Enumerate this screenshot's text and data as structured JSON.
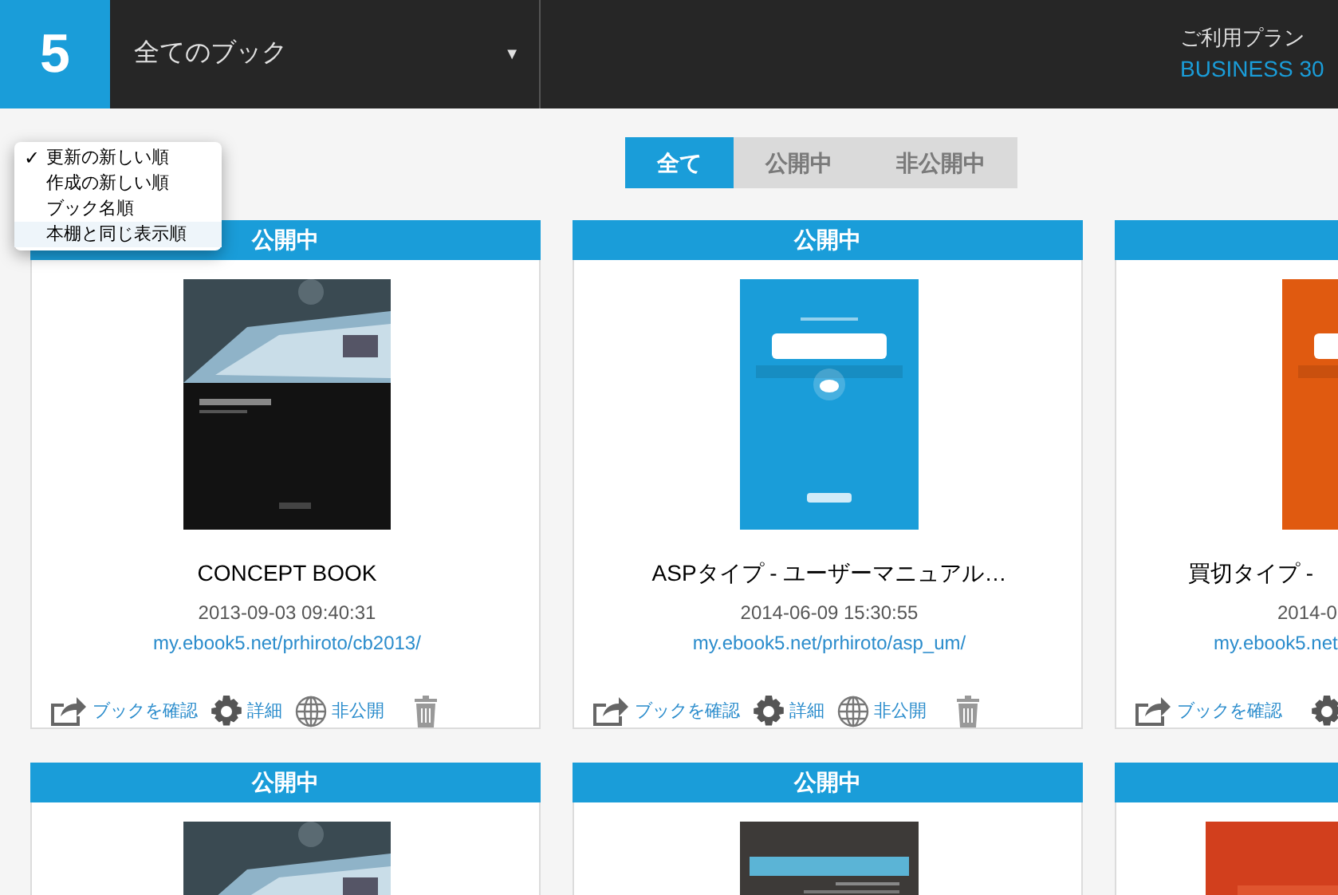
{
  "header": {
    "logo": "5",
    "book_selector": {
      "label": "全てのブック",
      "caret": "▼"
    },
    "plan_label": "ご利用プラン",
    "plan_name": "BUSINESS 30"
  },
  "sort_menu": {
    "check_mark": "✓",
    "items": [
      {
        "label": "更新の新しい順",
        "selected": true,
        "highlighted": false
      },
      {
        "label": "作成の新しい順",
        "selected": false,
        "highlighted": false
      },
      {
        "label": "ブック名順",
        "selected": false,
        "highlighted": false
      },
      {
        "label": "本棚と同じ表示順",
        "selected": false,
        "highlighted": true
      }
    ]
  },
  "filter_tabs": [
    {
      "label": "全て",
      "selected": true
    },
    {
      "label": "公開中",
      "selected": false
    },
    {
      "label": "非公開中",
      "selected": false
    }
  ],
  "book_rows": [
    {
      "cards": [
        {
          "kind": "full",
          "status": "公開中",
          "title": "CONCEPT BOOK",
          "date": "2013-09-03 09:40:31",
          "url": "my.ebook5.net/prhiroto/cb2013/",
          "actions": [
            {
              "kind": "share",
              "label": "ブックを確認"
            },
            {
              "kind": "gear",
              "label": "詳細"
            },
            {
              "kind": "globe",
              "label": "非公開"
            },
            {
              "kind": "trash"
            }
          ]
        },
        {
          "kind": "full",
          "status": "公開中",
          "title": "ASPタイプ - ユーザーマニュアル…",
          "date": "2014-06-09 15:30:55",
          "url": "my.ebook5.net/prhiroto/asp_um/",
          "actions": [
            {
              "kind": "share",
              "label": "ブックを確認"
            },
            {
              "kind": "gear",
              "label": "詳細"
            },
            {
              "kind": "globe",
              "label": "非公開"
            },
            {
              "kind": "trash"
            }
          ]
        },
        {
          "kind": "clipped",
          "title": "買切タイプ -",
          "date": "2014-0",
          "url": "my.ebook5.net",
          "actions": [
            {
              "kind": "share",
              "label": "ブックを確認"
            },
            {
              "kind": "gear"
            }
          ]
        }
      ]
    },
    {
      "cards": [
        {
          "kind": "top",
          "status": "公開中"
        },
        {
          "kind": "top",
          "status": "公開中"
        },
        {
          "kind": "top-clipped"
        }
      ]
    }
  ]
}
